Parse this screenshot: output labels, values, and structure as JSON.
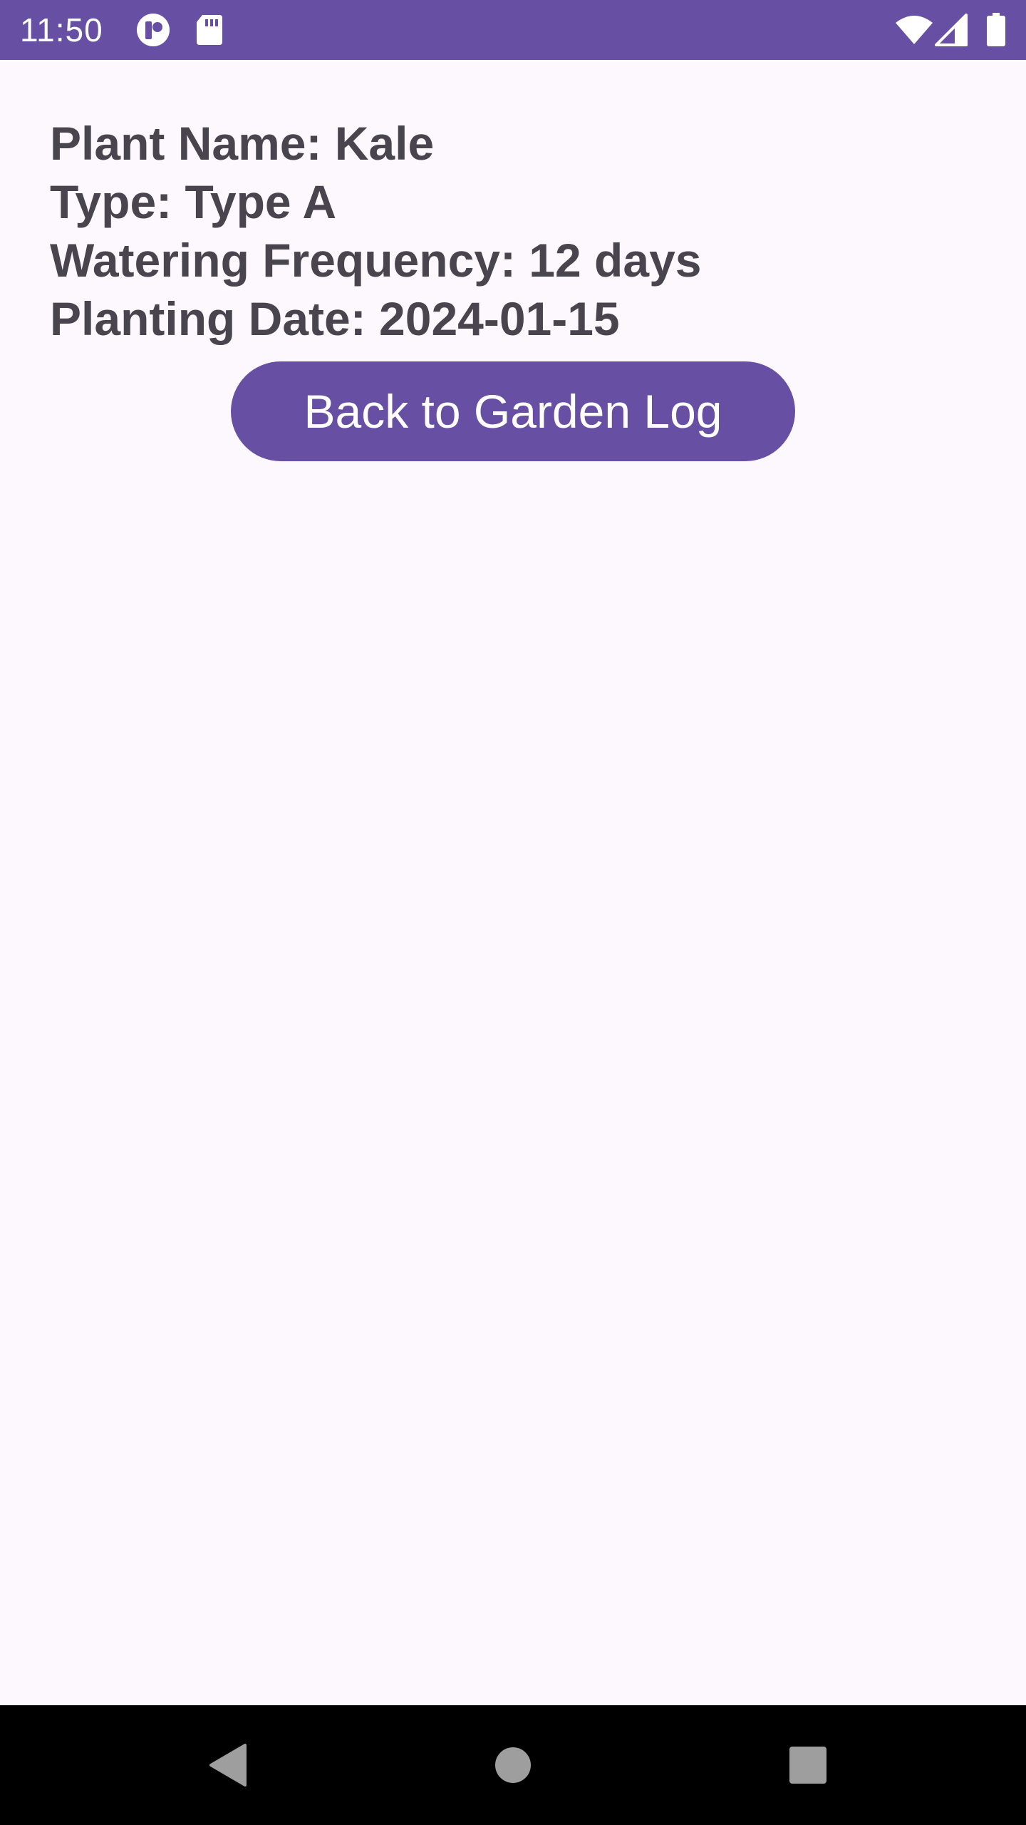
{
  "status_bar": {
    "time": "11:50",
    "icons": [
      "notification-app-icon",
      "sd-card-icon",
      "wifi-icon",
      "cellular-signal-icon",
      "battery-icon"
    ],
    "background_color": "#6750A4"
  },
  "plant_details": {
    "name_line": "Plant Name: Kale",
    "type_line": "Type: Type A",
    "watering_line": "Watering Frequency: 12 days",
    "planting_date_line": "Planting Date: 2024-01-15"
  },
  "actions": {
    "back_label": "Back to Garden Log"
  },
  "navigation_bar": {
    "icons": [
      "back-triangle-icon",
      "home-circle-icon",
      "recents-square-icon"
    ]
  },
  "colors": {
    "accent": "#6750A4",
    "background": "#FDF7FE",
    "text": "#49454F"
  }
}
